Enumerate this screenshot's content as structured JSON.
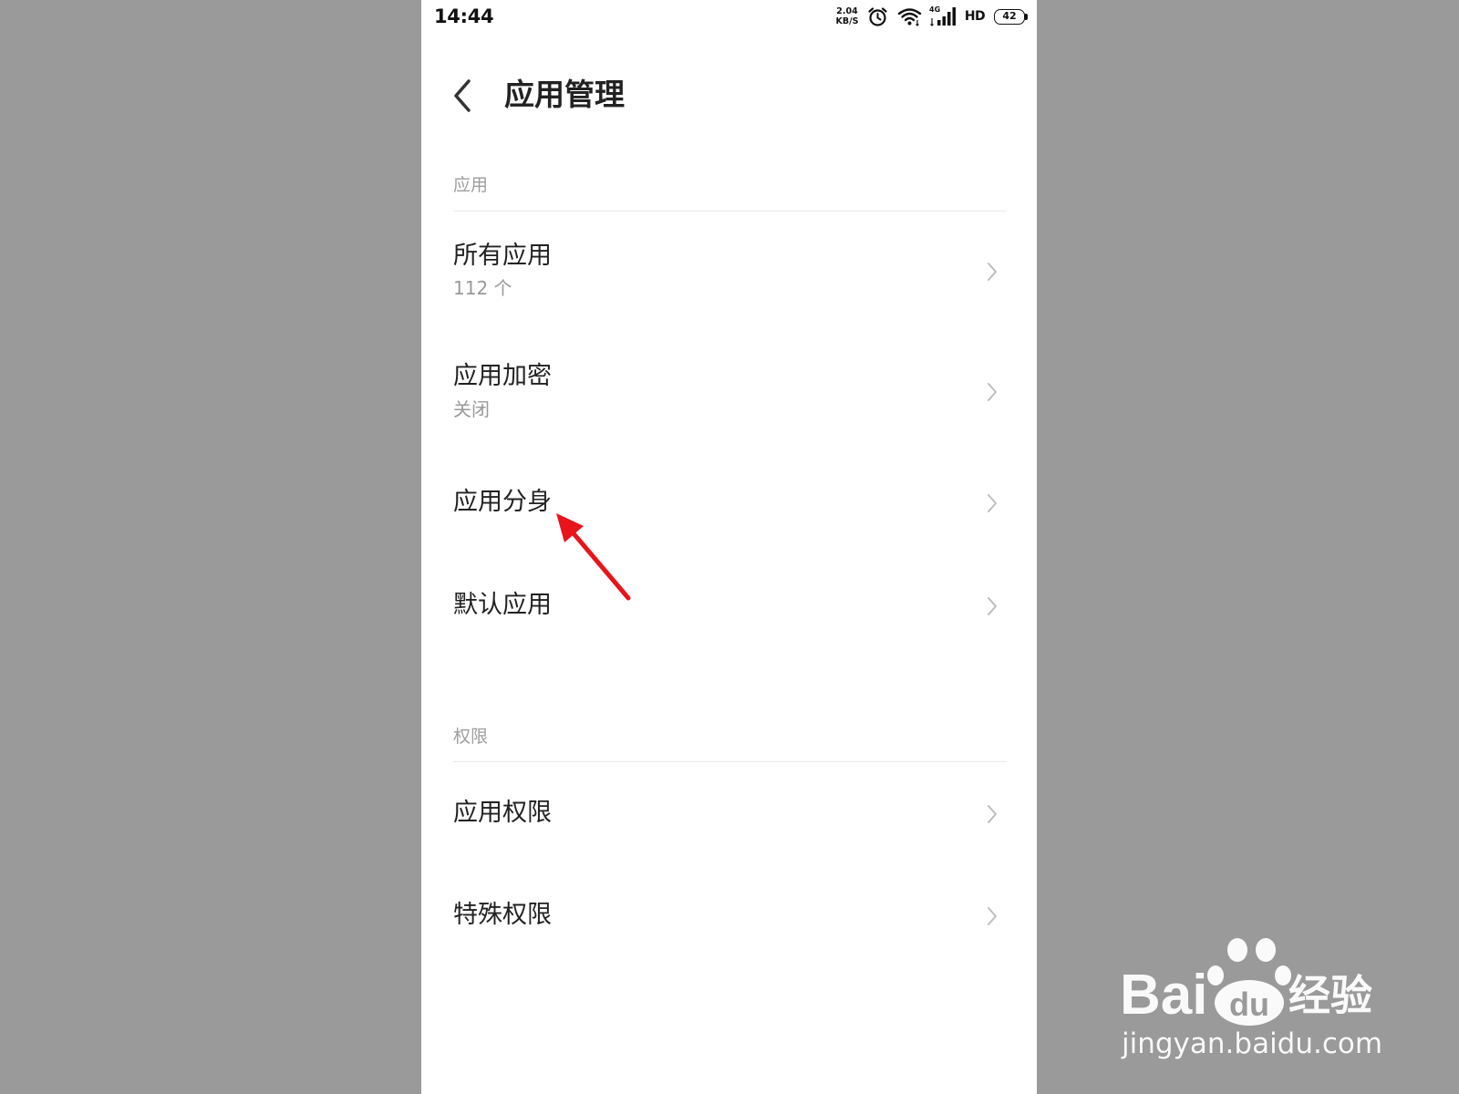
{
  "status_bar": {
    "time": "14:44",
    "network_speed_value": "2.04",
    "network_speed_unit": "KB/S",
    "alarm_icon": "alarm-clock-icon",
    "wifi_icon": "wifi-icon",
    "signal_icon": "cellular-signal-icon",
    "signal_label": "4G",
    "hd_label": "HD",
    "battery_icon": "battery-icon",
    "battery_level": "42"
  },
  "header": {
    "back_icon": "chevron-left-icon",
    "title": "应用管理"
  },
  "sections": [
    {
      "label": "应用",
      "items": [
        {
          "title": "所有应用",
          "subtitle": "112 个",
          "icon": "chevron-right-icon"
        },
        {
          "title": "应用加密",
          "subtitle": "关闭",
          "icon": "chevron-right-icon"
        },
        {
          "title": "应用分身",
          "icon": "chevron-right-icon"
        },
        {
          "title": "默认应用",
          "icon": "chevron-right-icon"
        }
      ]
    },
    {
      "label": "权限",
      "items": [
        {
          "title": "应用权限",
          "icon": "chevron-right-icon"
        },
        {
          "title": "特殊权限",
          "icon": "chevron-right-icon"
        }
      ]
    }
  ],
  "annotation": {
    "icon": "red-arrow-icon",
    "color": "#e8141b"
  },
  "watermark": {
    "logo_icon": "baidu-paw-icon",
    "brand_latin": "Bai",
    "brand_paw_text": "du",
    "brand_chinese": "经验",
    "url": "jingyan.baidu.com"
  },
  "colors": {
    "background": "#9a9a9a",
    "screen": "#ffffff",
    "text_primary": "#222222",
    "text_secondary": "#999999",
    "divider": "#ebebeb",
    "chevron": "#bdbdbd",
    "arrow": "#e8141b"
  }
}
